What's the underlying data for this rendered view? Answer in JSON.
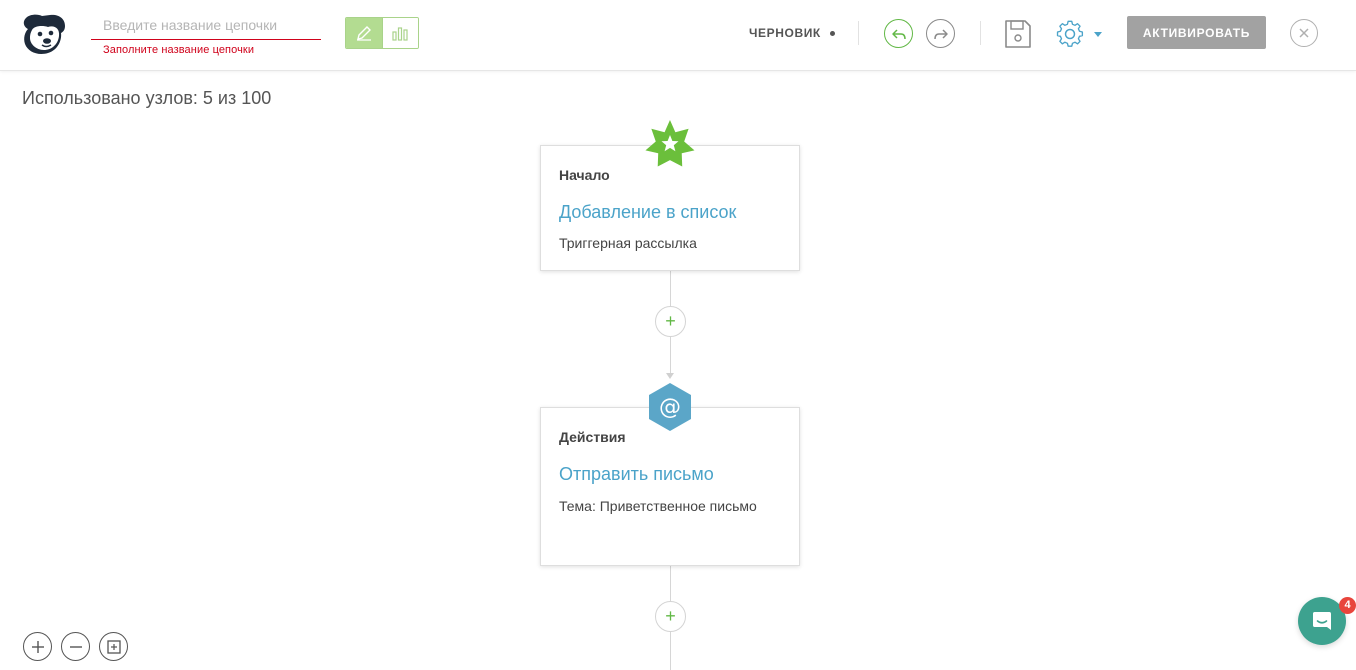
{
  "header": {
    "chain_name": {
      "value": "",
      "placeholder": "Введите название цепочки",
      "error": "Заполните название цепочки"
    },
    "mode_toggle": {
      "edit_icon": "pencil-icon",
      "stats_icon": "bar-chart-icon",
      "active": "edit"
    },
    "status": "ЧЕРНОВИК",
    "activate_label": "АКТИВИРОВАТЬ",
    "icons": {
      "undo": "undo-icon",
      "redo": "redo-icon",
      "save": "floppy-disk-icon",
      "settings": "gear-icon",
      "close": "close-icon"
    }
  },
  "canvas": {
    "nodes_used": "Использовано узлов: 5 из 100",
    "nodes": [
      {
        "type": "Начало",
        "title": "Добавление в список",
        "description": "Триггерная рассылка",
        "badge_icon": "star-icon",
        "badge_color": "#6bbf3b"
      },
      {
        "type": "Действия",
        "title": "Отправить письмо",
        "description": "Тема: Приветственное письмо",
        "badge_icon": "at-sign-icon",
        "badge_color": "#5ba6c8"
      }
    ],
    "add_symbol": "+"
  },
  "zoom_controls": {
    "zoom_in_icon": "zoom-in-icon",
    "zoom_out_icon": "zoom-out-icon",
    "fit_icon": "fit-to-screen-icon"
  },
  "chat": {
    "icon": "chat-icon",
    "unread_count": "4"
  },
  "colors": {
    "accent_green": "#62b846",
    "link_blue": "#4ba3c9",
    "error_red": "#d0021b",
    "chat_teal": "#3da28f",
    "activate_gray": "#a2a2a2"
  }
}
